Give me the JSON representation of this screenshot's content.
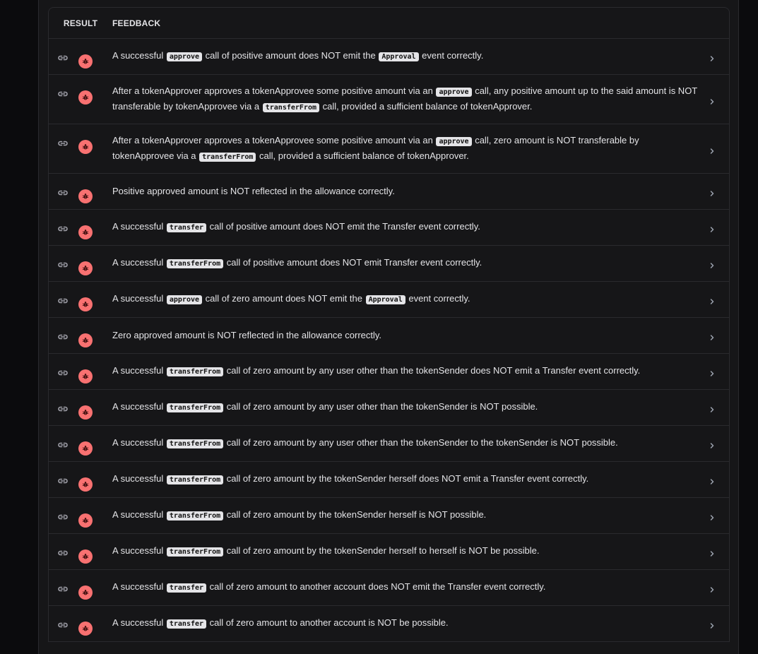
{
  "table": {
    "headers": {
      "result": "RESULT",
      "feedback": "FEEDBACK"
    },
    "rows": [
      {
        "parts": [
          "A successful ",
          {
            "code": "approve"
          },
          " call of positive amount does NOT emit the ",
          {
            "code": "Approval"
          },
          " event correctly."
        ],
        "tall": false
      },
      {
        "parts": [
          "After a tokenApprover approves a tokenApprovee some positive amount via an ",
          {
            "code": "approve"
          },
          " call, any positive amount up to the said amount is NOT transferable by tokenApprovee via a ",
          {
            "code": "transferFrom"
          },
          " call, provided a sufficient balance of tokenApprover."
        ],
        "tall": true
      },
      {
        "parts": [
          "After a tokenApprover approves a tokenApprovee some positive amount via an ",
          {
            "code": "approve"
          },
          " call, zero amount is NOT transferable by tokenApprovee via a ",
          {
            "code": "transferFrom"
          },
          " call, provided a sufficient balance of tokenApprover."
        ],
        "tall": true
      },
      {
        "parts": [
          "Positive approved amount is NOT reflected in the allowance correctly."
        ],
        "tall": false
      },
      {
        "parts": [
          "A successful ",
          {
            "code": "transfer"
          },
          " call of positive amount does NOT emit the Transfer event correctly."
        ],
        "tall": false
      },
      {
        "parts": [
          "A successful ",
          {
            "code": "transferFrom"
          },
          " call of positive amount does NOT emit Transfer event correctly."
        ],
        "tall": false
      },
      {
        "parts": [
          "A successful ",
          {
            "code": "approve"
          },
          " call of zero amount does NOT emit the ",
          {
            "code": "Approval"
          },
          " event correctly."
        ],
        "tall": false
      },
      {
        "parts": [
          "Zero approved amount is NOT reflected in the allowance correctly."
        ],
        "tall": false
      },
      {
        "parts": [
          "A successful ",
          {
            "code": "transferFrom"
          },
          " call of zero amount by any user other than the tokenSender does NOT emit a Transfer event correctly."
        ],
        "tall": false
      },
      {
        "parts": [
          "A successful ",
          {
            "code": "transferFrom"
          },
          " call of zero amount by any user other than the tokenSender is NOT possible."
        ],
        "tall": false
      },
      {
        "parts": [
          "A successful ",
          {
            "code": "transferFrom"
          },
          " call of zero amount by any user other than the tokenSender to the tokenSender is NOT possible."
        ],
        "tall": false
      },
      {
        "parts": [
          "A successful ",
          {
            "code": "transferFrom"
          },
          " call of zero amount by the tokenSender herself does NOT emit a Transfer event correctly."
        ],
        "tall": false
      },
      {
        "parts": [
          "A successful ",
          {
            "code": "transferFrom"
          },
          " call of zero amount by the tokenSender herself is NOT possible."
        ],
        "tall": false
      },
      {
        "parts": [
          "A successful ",
          {
            "code": "transferFrom"
          },
          " call of zero amount by the tokenSender herself to herself is NOT be possible."
        ],
        "tall": false
      },
      {
        "parts": [
          "A successful ",
          {
            "code": "transfer"
          },
          " call of zero amount to another account does NOT emit the Transfer event correctly."
        ],
        "tall": false
      },
      {
        "parts": [
          "A successful ",
          {
            "code": "transfer"
          },
          " call of zero amount to another account is NOT be possible."
        ],
        "tall": false
      }
    ]
  },
  "icons": {
    "link": "link-icon",
    "result": "bug-icon",
    "expand": "chevron-right-icon"
  },
  "colors": {
    "fail_badge": "#f87171",
    "background": "#0b0b0d",
    "panel": "#161618"
  }
}
